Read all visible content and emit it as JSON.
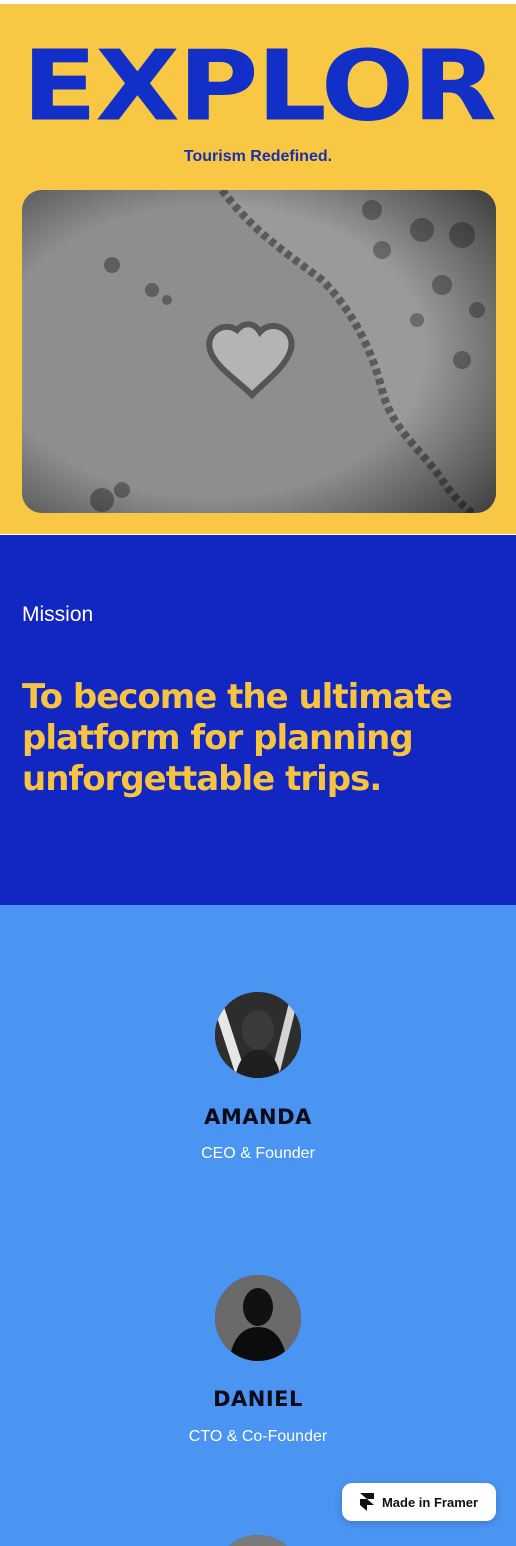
{
  "hero": {
    "title": "EXPLORE",
    "subtitle": "Tourism Redefined.",
    "image_alt": "aerial view of heart-shaped reef"
  },
  "mission": {
    "label": "Mission",
    "statement": "To become the ultimate platform for planning unforgettable trips."
  },
  "team": {
    "members": [
      {
        "name": "AMANDA",
        "role": "CEO & Founder"
      },
      {
        "name": "DANIEL",
        "role": "CTO & Co-Founder"
      }
    ]
  },
  "badge": {
    "label": "Made in Framer",
    "icon": "framer-logo-icon"
  },
  "colors": {
    "hero_bg": "#f8c744",
    "hero_text": "#1230c8",
    "mission_bg": "#1226c2",
    "mission_text": "#f6c440",
    "team_bg": "#4a94f2"
  }
}
